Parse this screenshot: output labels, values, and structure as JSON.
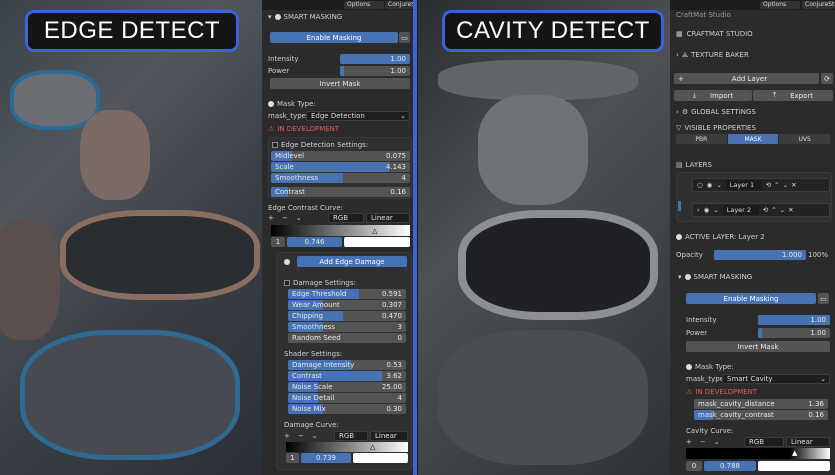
{
  "titles": {
    "left": "EDGE DETECT",
    "right": "CAVITY DETECT"
  },
  "topbar": {
    "options": "Options",
    "conjure": "ConjureSt"
  },
  "left_panel": {
    "section": "SMART MASKING",
    "enable": "Enable Masking",
    "intensity": {
      "label": "Intensity",
      "value": "1.00"
    },
    "power": {
      "label": "Power",
      "value": "1.00"
    },
    "invert": "Invert Mask",
    "mask_type_header": "Mask Type:",
    "mask_type_label": "mask_type:",
    "mask_type_value": "Edge Detection",
    "warning": "IN DEVELOPMENT",
    "edge_settings": "Edge Detection Settings:",
    "midlevel": {
      "label": "Midlevel",
      "value": "0.075",
      "fill": 0.15
    },
    "scale": {
      "label": "Scale",
      "value": "4.143",
      "fill": 0.85
    },
    "smoothness": {
      "label": "Smoothness",
      "value": "4",
      "fill": 0.55
    },
    "contrast": {
      "label": "Contrast",
      "value": "0.16",
      "fill": 0.12
    },
    "curve_header": "Edge Contrast Curve:",
    "curve_channel": "RGB",
    "curve_interp": "Linear",
    "curve_point": "1",
    "curve_value": "0.746",
    "add_damage": "Add Edge Damage",
    "damage_settings": "Damage Settings:",
    "edge_threshold": {
      "label": "Edge Threshold",
      "value": "0.591",
      "fill": 0.6
    },
    "wear_amount": {
      "label": "Wear Amount",
      "value": "0.307",
      "fill": 0.3
    },
    "chipping": {
      "label": "Chipping",
      "value": "0.470",
      "fill": 0.47
    },
    "dmg_smooth": {
      "label": "Smoothness",
      "value": "3",
      "fill": 0.3
    },
    "random_seed": {
      "label": "Random Seed",
      "value": "0",
      "fill": 0.0
    },
    "shader_settings": "Shader Settings:",
    "damage_intensity": {
      "label": "Damage Intensity",
      "value": "0.53",
      "fill": 0.53
    },
    "sh_contrast": {
      "label": "Contrast",
      "value": "3.62",
      "fill": 0.8
    },
    "noise_scale": {
      "label": "Noise Scale",
      "value": "25.00",
      "fill": 0.25
    },
    "noise_detail": {
      "label": "Noise Detail",
      "value": "4",
      "fill": 0.25
    },
    "noise_mix": {
      "label": "Noise Mix",
      "value": "0.30",
      "fill": 0.3
    },
    "damage_curve": "Damage Curve:",
    "dc_point": "1",
    "dc_value": "0.739"
  },
  "right_panel": {
    "studio_top": "CraftMat Studio",
    "studio": "CRAFTMAT STUDIO",
    "texture_baker": "TEXTURE BAKER",
    "add_layer": "Add Layer",
    "import": "Import",
    "export": "Export",
    "global_settings": "GLOBAL SETTINGS",
    "visible_properties": "VISIBLE PROPERTIES",
    "tabs": [
      "PBR",
      "MASK",
      "UVS"
    ],
    "layers": "LAYERS",
    "layer1": "Layer 1",
    "layer2": "Layer 2",
    "active_layer": "ACTIVE LAYER: Layer 2",
    "opacity": {
      "label": "Opacity",
      "value": "1.000",
      "pct": "100%"
    },
    "section": "SMART MASKING",
    "enable": "Enable Masking",
    "intensity": {
      "label": "Intensity",
      "value": "1.00"
    },
    "power": {
      "label": "Power",
      "value": "1.00"
    },
    "invert": "Invert Mask",
    "mask_type_header": "Mask Type:",
    "mask_type_label": "mask_type:",
    "mask_type_value": "Smart Cavity",
    "warning": "IN DEVELOPMENT",
    "cavity_distance": {
      "label": "mask_cavity_distance",
      "value": "1.36"
    },
    "cavity_contrast": {
      "label": "mask_cavity_contrast",
      "value": "0.16"
    },
    "curve_header": "Cavity Curve:",
    "curve_channel": "RGB",
    "curve_interp": "Linear",
    "curve_point": "0",
    "curve_value": "0.788"
  }
}
